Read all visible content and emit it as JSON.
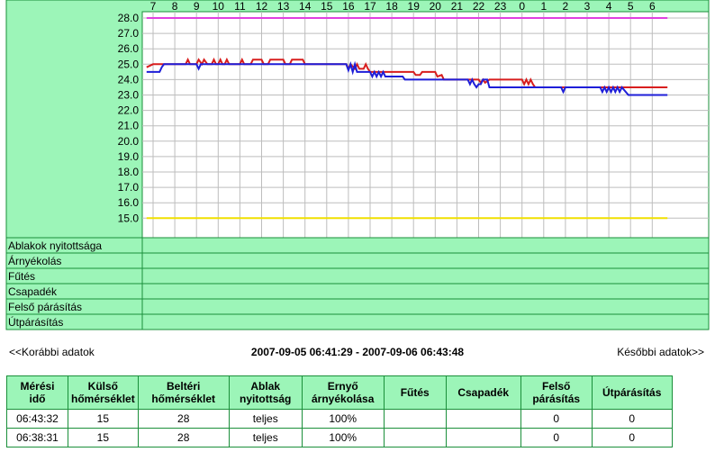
{
  "chart_data": {
    "type": "line",
    "x_ticks": [
      "7",
      "8",
      "9",
      "10",
      "11",
      "12",
      "13",
      "14",
      "15",
      "16",
      "17",
      "18",
      "19",
      "20",
      "21",
      "22",
      "23",
      "0",
      "1",
      "2",
      "3",
      "4",
      "5",
      "6"
    ],
    "y_ticks": [
      "28.0",
      "27.0",
      "26.0",
      "25.0",
      "24.0",
      "23.0",
      "22.0",
      "21.0",
      "20.0",
      "19.0",
      "18.0",
      "17.0",
      "16.0",
      "15.0"
    ],
    "ylim": [
      15,
      28
    ],
    "status_rows": [
      "Ablakok nyitottsága",
      "Árnyékolás",
      "Fűtés",
      "Csapadék",
      "Felső párásítás",
      "Útpárásítás"
    ],
    "series": [
      {
        "color": "#e040e0",
        "points": [
          [
            6.7,
            28
          ],
          [
            30.7,
            28
          ]
        ]
      },
      {
        "color": "#f0e000",
        "points": [
          [
            6.7,
            15
          ],
          [
            30.7,
            15
          ]
        ]
      },
      {
        "color": "#d81e1e",
        "points": [
          [
            6.7,
            24.8
          ],
          [
            7.0,
            25
          ],
          [
            8.5,
            25
          ],
          [
            8.6,
            25.3
          ],
          [
            8.7,
            25
          ],
          [
            9.0,
            25
          ],
          [
            9.1,
            25.3
          ],
          [
            9.25,
            25
          ],
          [
            9.35,
            25.3
          ],
          [
            9.5,
            25
          ],
          [
            9.7,
            25
          ],
          [
            9.8,
            25.3
          ],
          [
            9.9,
            25
          ],
          [
            10.0,
            25
          ],
          [
            10.1,
            25.3
          ],
          [
            10.2,
            25
          ],
          [
            10.3,
            25
          ],
          [
            10.4,
            25.3
          ],
          [
            10.5,
            25
          ],
          [
            11.0,
            25
          ],
          [
            11.1,
            25.3
          ],
          [
            11.2,
            25
          ],
          [
            11.5,
            25
          ],
          [
            11.6,
            25.3
          ],
          [
            12.0,
            25.3
          ],
          [
            12.1,
            25
          ],
          [
            12.3,
            25
          ],
          [
            12.4,
            25.3
          ],
          [
            13.0,
            25.3
          ],
          [
            13.1,
            25
          ],
          [
            13.3,
            25
          ],
          [
            13.4,
            25.3
          ],
          [
            13.9,
            25.3
          ],
          [
            14.0,
            25
          ],
          [
            15.9,
            25
          ],
          [
            16.0,
            24.7
          ],
          [
            16.1,
            25
          ],
          [
            16.3,
            24.7
          ],
          [
            16.4,
            25
          ],
          [
            16.5,
            24.7
          ],
          [
            16.7,
            24.7
          ],
          [
            16.8,
            25
          ],
          [
            16.9,
            24.7
          ],
          [
            17.0,
            24.5
          ],
          [
            19.0,
            24.5
          ],
          [
            19.1,
            24.3
          ],
          [
            19.3,
            24.3
          ],
          [
            19.4,
            24.5
          ],
          [
            20.0,
            24.5
          ],
          [
            20.1,
            24.2
          ],
          [
            20.3,
            24.3
          ],
          [
            20.4,
            24.0
          ],
          [
            22.0,
            24.0
          ],
          [
            22.1,
            23.8
          ],
          [
            22.2,
            24.0
          ],
          [
            22.3,
            23.8
          ],
          [
            22.5,
            24.0
          ],
          [
            24.0,
            24.0
          ],
          [
            24.1,
            23.7
          ],
          [
            24.2,
            24.0
          ],
          [
            24.3,
            23.7
          ],
          [
            24.4,
            24.0
          ],
          [
            24.5,
            23.7
          ],
          [
            24.6,
            23.5
          ],
          [
            30.7,
            23.5
          ]
        ]
      },
      {
        "color": "#1e1ed8",
        "points": [
          [
            6.7,
            24.5
          ],
          [
            7.3,
            24.5
          ],
          [
            7.4,
            24.8
          ],
          [
            7.5,
            25
          ],
          [
            9.0,
            25
          ],
          [
            9.1,
            24.7
          ],
          [
            9.2,
            25
          ],
          [
            15.9,
            25
          ],
          [
            16.0,
            24.6
          ],
          [
            16.1,
            25
          ],
          [
            16.2,
            24.5
          ],
          [
            16.3,
            25
          ],
          [
            16.4,
            24.5
          ],
          [
            17.0,
            24.5
          ],
          [
            17.1,
            24.2
          ],
          [
            17.2,
            24.5
          ],
          [
            17.3,
            24.2
          ],
          [
            17.4,
            24.5
          ],
          [
            17.5,
            24.2
          ],
          [
            17.6,
            24.5
          ],
          [
            17.7,
            24.2
          ],
          [
            18.5,
            24.2
          ],
          [
            18.6,
            24.0
          ],
          [
            20.0,
            24.0
          ],
          [
            21.5,
            24.0
          ],
          [
            21.6,
            23.7
          ],
          [
            21.7,
            24.0
          ],
          [
            21.8,
            23.7
          ],
          [
            21.9,
            23.5
          ],
          [
            22.0,
            23.7
          ],
          [
            22.1,
            23.7
          ],
          [
            22.2,
            24.0
          ],
          [
            22.4,
            24.0
          ],
          [
            22.5,
            23.5
          ],
          [
            25.8,
            23.5
          ],
          [
            25.9,
            23.2
          ],
          [
            26.0,
            23.5
          ],
          [
            27.6,
            23.5
          ],
          [
            27.7,
            23.2
          ],
          [
            27.8,
            23.5
          ],
          [
            27.9,
            23.2
          ],
          [
            28.0,
            23.5
          ],
          [
            28.1,
            23.2
          ],
          [
            28.2,
            23.5
          ],
          [
            28.3,
            23.2
          ],
          [
            28.4,
            23.5
          ],
          [
            28.5,
            23.2
          ],
          [
            28.6,
            23.5
          ],
          [
            28.9,
            23.0
          ],
          [
            30.7,
            23.0
          ]
        ]
      }
    ]
  },
  "nav": {
    "prev": "<<Korábbi adatok",
    "range": "2007-09-05 06:41:29 - 2007-09-06 06:43:48",
    "next": "Későbbi adatok>>"
  },
  "table": {
    "headers": [
      [
        "Mérési",
        "idő"
      ],
      [
        "Külső",
        "hőmérséklet"
      ],
      [
        "Beltéri",
        "hőmérséklet"
      ],
      [
        "Ablak",
        "nyitottság"
      ],
      [
        "Ernyő",
        "árnyékolása"
      ],
      [
        "Fűtés"
      ],
      [
        "Csapadék"
      ],
      [
        "Felső",
        "párásítás"
      ],
      [
        "Útpárásítás"
      ]
    ],
    "rows": [
      [
        "06:43:32",
        "15",
        "28",
        "teljes",
        "100%",
        "",
        "",
        "0",
        "0"
      ],
      [
        "06:38:31",
        "15",
        "28",
        "teljes",
        "100%",
        "",
        "",
        "0",
        "0"
      ]
    ]
  }
}
